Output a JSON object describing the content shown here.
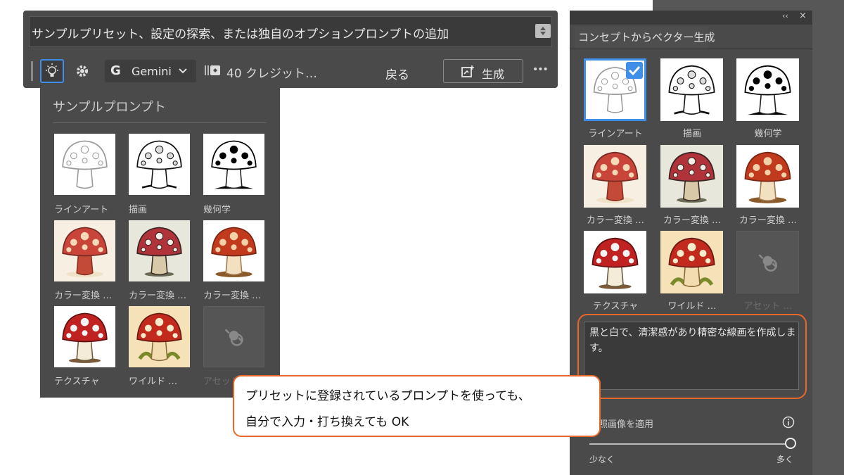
{
  "prompt_bar": {
    "placeholder": "サンプルプリセット、設定の探索、または独自のオプションプロンプトの追加"
  },
  "toolbar": {
    "model": "Gemini",
    "credits": "40 クレジット…",
    "back_label": "戻る",
    "generate_label": "生成",
    "more_label": "•••"
  },
  "sample_panel": {
    "title": "サンプルプロンプト",
    "items": [
      {
        "label": "ラインアート",
        "style": "lineart"
      },
      {
        "label": "描画",
        "style": "drawing"
      },
      {
        "label": "幾何学",
        "style": "geometric"
      },
      {
        "label": "カラー変換 …",
        "style": "color1"
      },
      {
        "label": "カラー変換 …",
        "style": "color2"
      },
      {
        "label": "カラー変換 …",
        "style": "color3"
      },
      {
        "label": "テクスチャ",
        "style": "texture"
      },
      {
        "label": "ワイルド …",
        "style": "wild"
      },
      {
        "label": "アセット …",
        "style": "asset"
      }
    ]
  },
  "right_panel": {
    "tab": "コンセプトからベクター生成",
    "items": [
      {
        "label": "ラインアート",
        "selected": true
      },
      {
        "label": "描画",
        "selected": false
      },
      {
        "label": "幾何学",
        "selected": false
      },
      {
        "label": "カラー変換 …",
        "selected": false
      },
      {
        "label": "カラー変換 …",
        "selected": false
      },
      {
        "label": "カラー変換 …",
        "selected": false
      },
      {
        "label": "テクスチャ",
        "selected": false
      },
      {
        "label": "ワイルド …",
        "selected": false
      },
      {
        "label": "アセット …",
        "selected": false
      }
    ],
    "prompt_text": "黒と白で、清潔感があり精密な線画を作成します。",
    "apply_label": "参照画像を適用",
    "slider_min": "少なく",
    "slider_max": "多く",
    "slider_value": 1.0
  },
  "callout": {
    "line1": "プリセットに登録されているプロンプトを使っても、",
    "line2": "自分で入力・打ち換えても OK"
  },
  "colors": {
    "accent_orange": "#e8672a",
    "selection_blue": "#3f8fe8",
    "panel": "#4a4a4a"
  }
}
